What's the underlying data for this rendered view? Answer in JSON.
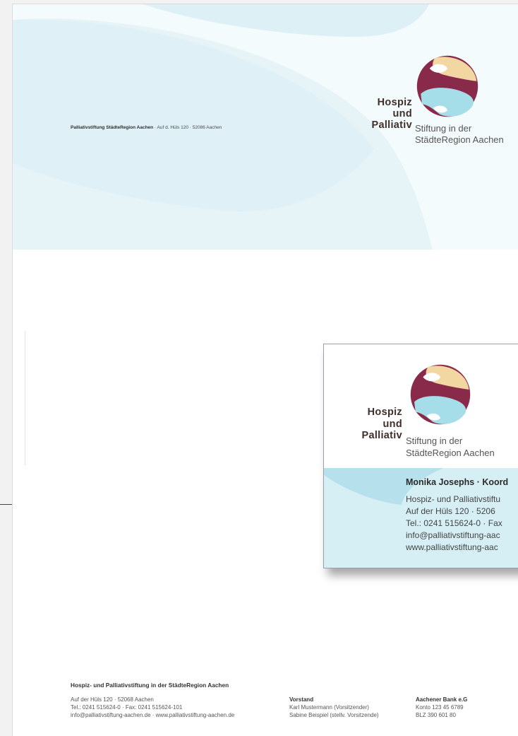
{
  "letterhead": {
    "sender_line_bold": "Palliativstiftung StädteRegion Aachen",
    "sender_line_rest": " · Auf d. Hüls 120 · 52086 Aachen"
  },
  "logo": {
    "line1": "Hospiz",
    "line2": "und",
    "line3": "Palliativ",
    "sub1": "Stiftung in der",
    "sub2": "StädteRegion Aachen",
    "colors": {
      "maroon": "#8a2a4a",
      "sand": "#f2d7a2",
      "aqua": "#a5dde8",
      "text": "#3f2f2a"
    }
  },
  "card": {
    "name": "Monika Josephs · Koord",
    "lines": [
      "Hospiz- und Palliativstiftu",
      "Auf der Hüls 120 · 5206",
      "Tel.: 0241 515624-0 · Fax",
      "info@palliativstiftung-aac",
      "www.palliativstiftung-aac"
    ]
  },
  "footer": {
    "title": "Hospiz- und Palliativstiftung in der StädteRegion Aachen",
    "address": [
      "Auf der Hüls 120 · 52068 Aachen",
      "Tel.: 0241 515624-0 · Fax: 0241 515624-101",
      "info@palliativstiftung-aachen.de · www.palliativstiftung-aachen.de"
    ],
    "board_title": "Vorstand",
    "board": [
      "Karl Mustermann (Vorsitzender)",
      "Sabine Beispiel (stellv. Vorsitzende)"
    ],
    "bank_title": "Aachener Bank e.G",
    "bank": [
      "Konto 123 45 6789",
      "BLZ 390 601 80"
    ]
  }
}
